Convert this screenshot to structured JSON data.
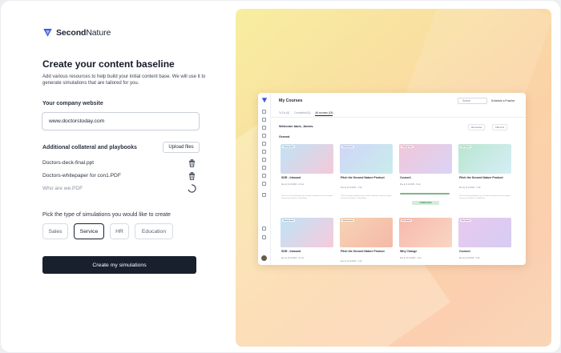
{
  "brand": {
    "name_bold": "Second",
    "name_light": "Nature"
  },
  "header": {
    "title": "Create your content baseline",
    "subtitle": "Add various resources to help build your initial content base. We will use it to generate simulations that are tailored for you."
  },
  "website": {
    "label": "Your company website",
    "value": "www.doctorstoday.com"
  },
  "collateral": {
    "label": "Additional collateral and playbooks",
    "upload_label": "Upload files",
    "files": [
      {
        "name": "Doctors-deck-final.ppt",
        "status": "uploaded"
      },
      {
        "name": "Doctors-whitepaper for con1.PDF",
        "status": "uploaded"
      },
      {
        "name": "Who are we.PDF",
        "status": "uploading"
      }
    ]
  },
  "simulation_types": {
    "label": "Pick the type of simulations you would like to create",
    "options": [
      "Sales",
      "Service",
      "HR",
      "Education"
    ],
    "selected": "Service"
  },
  "cta": {
    "label": "Create my simulations"
  },
  "colors": {
    "primary": "#18202e",
    "accent_gradient_start": "#f7eea0",
    "accent_gradient_end": "#fbcfb0"
  },
  "preview": {
    "title": "My Courses",
    "search_placeholder": "Search",
    "schedule_label": "Schedule a Practice",
    "tabs": [
      "To Do (8)",
      "Completed (5)",
      "All courses (18)"
    ],
    "active_tab": "All courses (18)",
    "welcome": "Welcome back, James.",
    "filter_1": "All course",
    "filter_2": "Title A-Z",
    "section": "General",
    "cards": [
      {
        "tag": "Starting Soon",
        "title": "SDR - Inbound",
        "meta": "Due by 11.10.2023  ·  12 min",
        "desc": "This is the short simulation over, no other simulation can be first good lessons learn about us. Read More"
      },
      {
        "tag": "Starting Soon",
        "title": "Pitch the Second Nature Product",
        "meta": "Due by 11.10.2023  ·  4 min",
        "desc": "This is the long simulation over, no other simulation can be first good lessons learn about us. Read More"
      },
      {
        "tag": "Starting Soon",
        "title": "Course1",
        "meta": "Due by 9.12.2023  ·  6 min",
        "progress": 1.0,
        "done": "COMPLETED"
      },
      {
        "tag": "Not Started",
        "title": "Pitch the Second Nature Product",
        "meta": "Due by 11.10.2023  ·  4 min",
        "desc": "This is the long simulation over, no other simulation can be first good lessons learn about us. Read More"
      },
      {
        "tag": "Starting Soon",
        "title": "SDR - Inbound",
        "meta": "Due by 11.10.2023  ·  12 min"
      },
      {
        "tag": "Starting Soon",
        "title": "Pitch the Second Nature Product",
        "meta": "Due by 11.10.2023  ·  4 min"
      },
      {
        "tag": "Not Started",
        "title": "Why Change",
        "meta": "Due by 11.10.2023  ·  4 min"
      },
      {
        "tag": "Not Started",
        "title": "Course1",
        "meta": "Due by 9.12.2023  ·  6 min"
      }
    ]
  }
}
